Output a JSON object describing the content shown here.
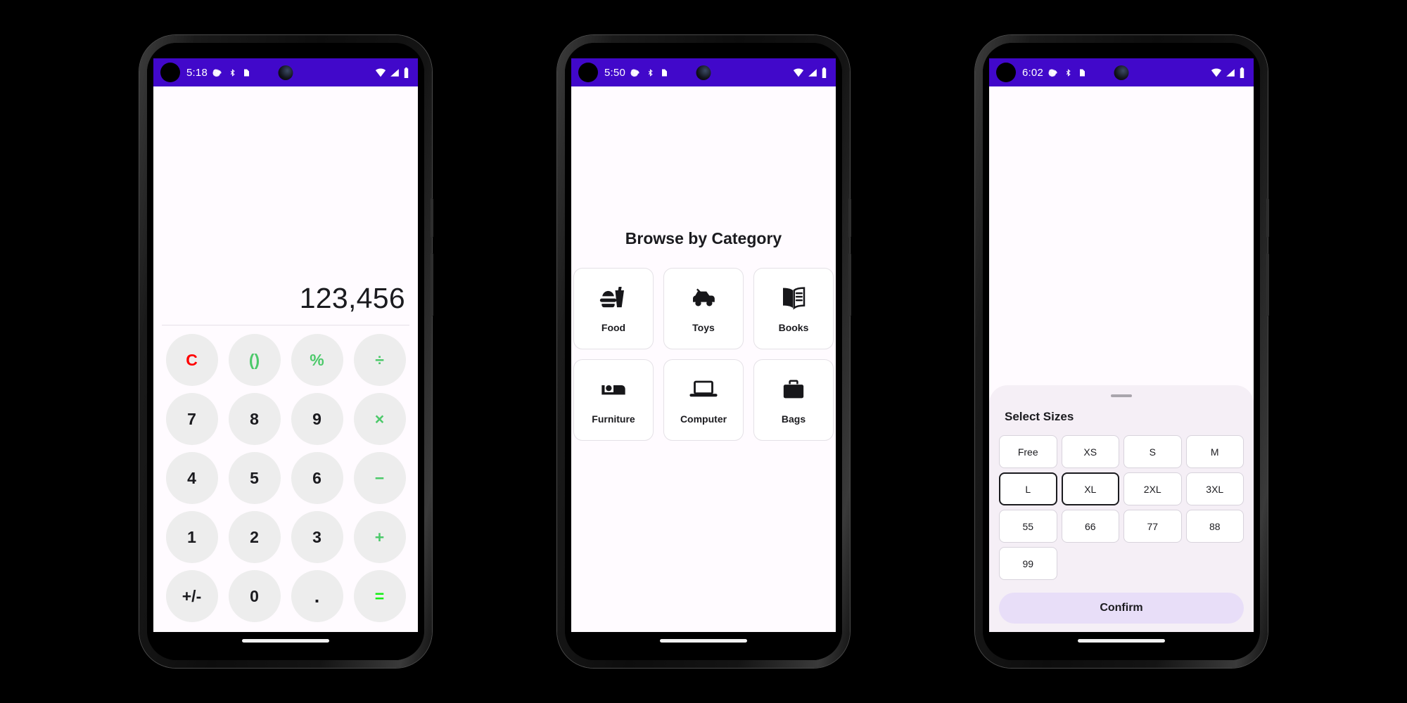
{
  "phones": [
    {
      "id": "calculator",
      "status_bar": {
        "time": "5:18",
        "icons": [
          "settings-gear-icon",
          "bluetooth-icon",
          "sd-card-icon",
          "wifi-icon",
          "cell-signal-icon",
          "battery-icon"
        ]
      },
      "calculator": {
        "display_value": "123,456",
        "keys": [
          {
            "label": "C",
            "kind": "clear",
            "name": "clear-key"
          },
          {
            "label": "()",
            "kind": "fn",
            "name": "parentheses-key"
          },
          {
            "label": "%",
            "kind": "fn",
            "name": "percent-key"
          },
          {
            "label": "÷",
            "kind": "op",
            "name": "divide-key"
          },
          {
            "label": "7",
            "kind": "num",
            "name": "digit-7-key"
          },
          {
            "label": "8",
            "kind": "num",
            "name": "digit-8-key"
          },
          {
            "label": "9",
            "kind": "num",
            "name": "digit-9-key"
          },
          {
            "label": "×",
            "kind": "op",
            "name": "multiply-key"
          },
          {
            "label": "4",
            "kind": "num",
            "name": "digit-4-key"
          },
          {
            "label": "5",
            "kind": "num",
            "name": "digit-5-key"
          },
          {
            "label": "6",
            "kind": "num",
            "name": "digit-6-key"
          },
          {
            "label": "−",
            "kind": "op",
            "name": "minus-key"
          },
          {
            "label": "1",
            "kind": "num",
            "name": "digit-1-key"
          },
          {
            "label": "2",
            "kind": "num",
            "name": "digit-2-key"
          },
          {
            "label": "3",
            "kind": "num",
            "name": "digit-3-key"
          },
          {
            "label": "+",
            "kind": "op",
            "name": "plus-key"
          },
          {
            "label": "+/-",
            "kind": "num",
            "name": "sign-toggle-key"
          },
          {
            "label": "0",
            "kind": "num",
            "name": "digit-0-key"
          },
          {
            "label": ".",
            "kind": "dot",
            "name": "decimal-point-key"
          },
          {
            "label": "=",
            "kind": "eq",
            "name": "equals-key"
          }
        ]
      }
    },
    {
      "id": "category",
      "status_bar": {
        "time": "5:50",
        "icons": [
          "settings-gear-icon",
          "bluetooth-icon",
          "sd-card-icon",
          "wifi-icon",
          "cell-signal-icon",
          "battery-icon"
        ]
      },
      "category": {
        "title": "Browse by Category",
        "items": [
          {
            "label": "Food",
            "icon": "fast-food-icon"
          },
          {
            "label": "Toys",
            "icon": "toy-car-icon"
          },
          {
            "label": "Books",
            "icon": "open-book-icon"
          },
          {
            "label": "Furniture",
            "icon": "bed-icon"
          },
          {
            "label": "Computer",
            "icon": "laptop-icon"
          },
          {
            "label": "Bags",
            "icon": "briefcase-icon"
          }
        ]
      }
    },
    {
      "id": "sizes",
      "status_bar": {
        "time": "6:02",
        "icons": [
          "settings-gear-icon",
          "bluetooth-icon",
          "sd-card-icon",
          "wifi-icon",
          "cell-signal-icon",
          "battery-icon"
        ]
      },
      "size_sheet": {
        "title": "Select Sizes",
        "sizes": [
          {
            "label": "Free",
            "selected": false
          },
          {
            "label": "XS",
            "selected": false
          },
          {
            "label": "S",
            "selected": false
          },
          {
            "label": "M",
            "selected": false
          },
          {
            "label": "L",
            "selected": true
          },
          {
            "label": "XL",
            "selected": true
          },
          {
            "label": "2XL",
            "selected": false
          },
          {
            "label": "3XL",
            "selected": false
          },
          {
            "label": "55",
            "selected": false
          },
          {
            "label": "66",
            "selected": false
          },
          {
            "label": "77",
            "selected": false
          },
          {
            "label": "88",
            "selected": false
          },
          {
            "label": "99",
            "selected": false
          }
        ],
        "confirm_label": "Confirm"
      }
    }
  ],
  "theme": {
    "status_bar_bg": "#4108CA",
    "screen_bg": "#FFFBFF",
    "key_bg": "#EDEDED",
    "clear_color": "#FF0000",
    "operator_color": "#4CC96A",
    "equals_color": "#13F013",
    "sheet_bg": "#F5EFF6",
    "confirm_bg": "#E8DEF8",
    "selected_border": "#1b1b1f"
  }
}
